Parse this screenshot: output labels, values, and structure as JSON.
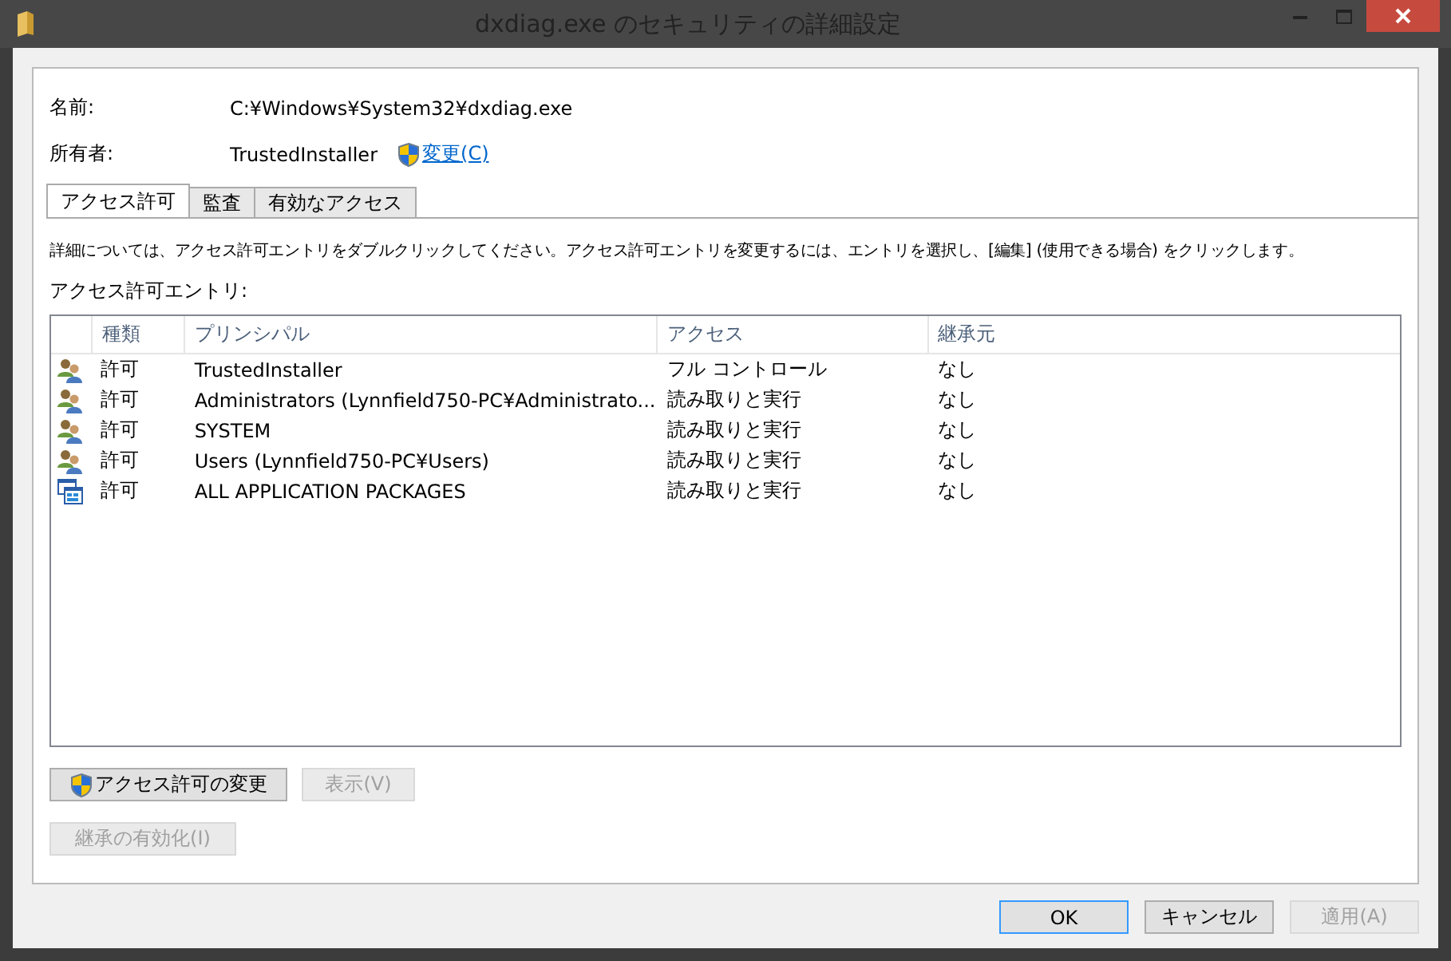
{
  "window": {
    "title": "dxdiag.exe のセキュリティの詳細設定"
  },
  "fields": [
    {
      "label": "名前:",
      "value": "C:¥Windows¥System32¥dxdiag.exe"
    },
    {
      "label": "所有者:",
      "value": "TrustedInstaller",
      "link": "変更(C)"
    }
  ],
  "tabs": [
    {
      "label": "アクセス許可",
      "selected": true
    },
    {
      "label": "監査",
      "selected": false
    },
    {
      "label": "有効なアクセス",
      "selected": false
    }
  ],
  "instructions": "詳細については、アクセス許可エントリをダブルクリックしてください。アクセス許可エントリを変更するには、エントリを選択し、[編集] (使用できる場合) をクリックします。",
  "entries_label": "アクセス許可エントリ:",
  "table": {
    "columns": [
      "種類",
      "プリンシパル",
      "アクセス",
      "継承元"
    ],
    "rows": [
      {
        "kind": "group",
        "cells": [
          "許可",
          "TrustedInstaller",
          "フル コントロール",
          "なし"
        ]
      },
      {
        "kind": "group",
        "cells": [
          "許可",
          "Administrators (Lynnfield750-PC¥Administrato...",
          "読み取りと実行",
          "なし"
        ]
      },
      {
        "kind": "group",
        "cells": [
          "許可",
          "SYSTEM",
          "読み取りと実行",
          "なし"
        ]
      },
      {
        "kind": "group",
        "cells": [
          "許可",
          "Users (Lynnfield750-PC¥Users)",
          "読み取りと実行",
          "なし"
        ]
      },
      {
        "kind": "package",
        "cells": [
          "許可",
          "ALL APPLICATION PACKAGES",
          "読み取りと実行",
          "なし"
        ]
      }
    ]
  },
  "actions": [
    {
      "label": "アクセス許可の変更",
      "shield": true,
      "disabled": false
    },
    {
      "label": "表示(V)",
      "shield": false,
      "disabled": true
    }
  ],
  "inherit_button": {
    "label": "継承の有効化(I)",
    "disabled": true
  },
  "dialog_buttons": [
    {
      "label": "OK",
      "default": true,
      "disabled": false
    },
    {
      "label": "キャンセル",
      "default": false,
      "disabled": false
    },
    {
      "label": "適用(A)",
      "default": false,
      "disabled": true
    }
  ]
}
